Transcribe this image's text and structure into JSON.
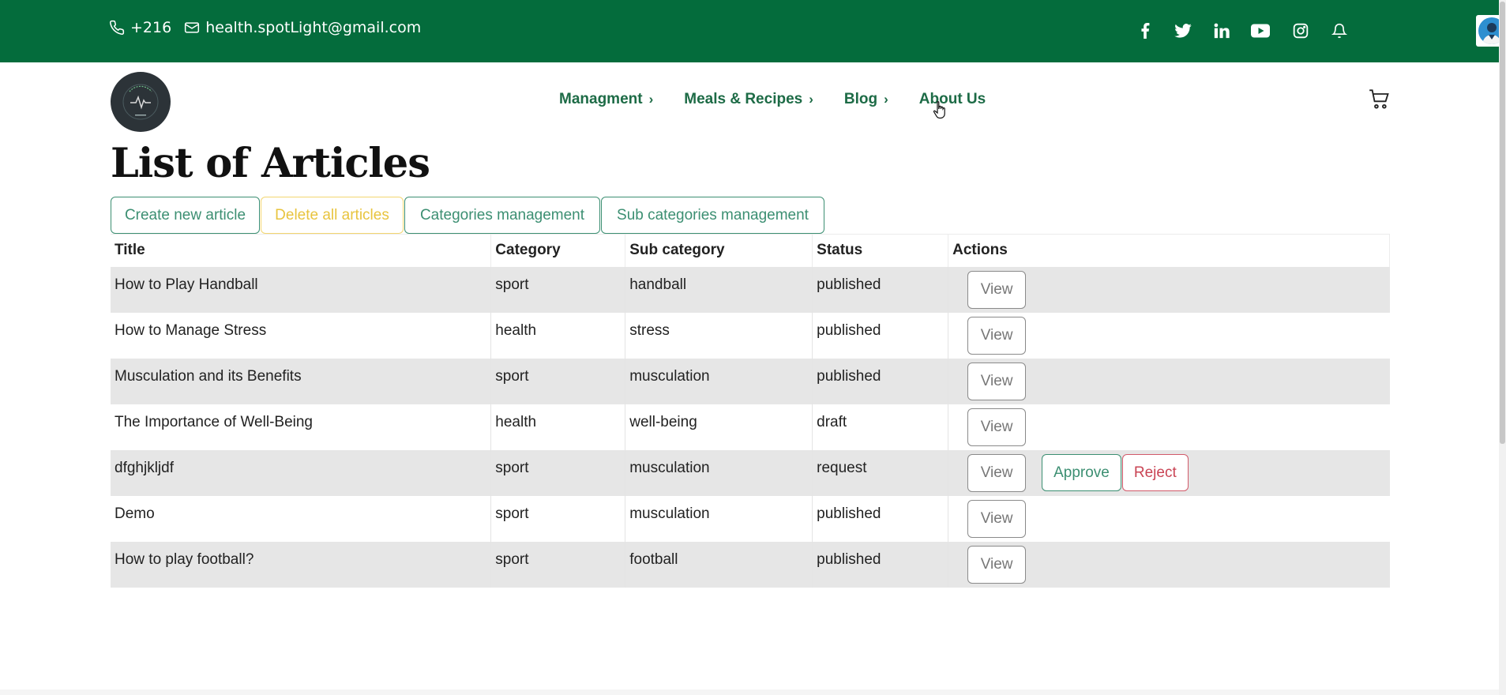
{
  "topbar": {
    "phone": "+216",
    "email": "health.spotLight@gmail.com",
    "social_icons": [
      "facebook-icon",
      "twitter-icon",
      "linkedin-icon",
      "youtube-icon",
      "instagram-icon",
      "bell-icon"
    ]
  },
  "nav": {
    "items": [
      {
        "label": "Managment"
      },
      {
        "label": "Meals & Recipes"
      },
      {
        "label": "Blog"
      },
      {
        "label": "About Us"
      }
    ]
  },
  "page": {
    "title": "List of Articles"
  },
  "toolbar": {
    "create_label": "Create new article",
    "delete_all_label": "Delete all articles",
    "categories_label": "Categories management",
    "subcategories_label": "Sub categories management"
  },
  "table": {
    "headers": {
      "title": "Title",
      "category": "Category",
      "subcategory": "Sub category",
      "status": "Status",
      "actions": "Actions"
    },
    "rows": [
      {
        "title": "How to Play Handball",
        "category": "sport",
        "subcategory": "handball",
        "status": "published",
        "view": "View"
      },
      {
        "title": "How to Manage Stress",
        "category": "health",
        "subcategory": "stress",
        "status": "published",
        "view": "View"
      },
      {
        "title": "Musculation and its Benefits",
        "category": "sport",
        "subcategory": "musculation",
        "status": "published",
        "view": "View"
      },
      {
        "title": "The Importance of Well-Being",
        "category": "health",
        "subcategory": "well-being",
        "status": "draft",
        "view": "View"
      },
      {
        "title": "dfghjkljdf",
        "category": "sport",
        "subcategory": "musculation",
        "status": "request",
        "view": "View",
        "approve": "Approve",
        "reject": "Reject"
      },
      {
        "title": "Demo",
        "category": "sport",
        "subcategory": "musculation",
        "status": "published",
        "view": "View"
      },
      {
        "title": "How to play football?",
        "category": "sport",
        "subcategory": "football",
        "status": "published",
        "view": "View"
      }
    ]
  },
  "colors": {
    "topbar_bg": "#046c3c",
    "nav_text": "#1d6b46",
    "accent_green": "#3c8f72",
    "accent_yellow": "#e8c43e",
    "accent_red": "#c94454",
    "row_alt": "#e6e6e6"
  }
}
